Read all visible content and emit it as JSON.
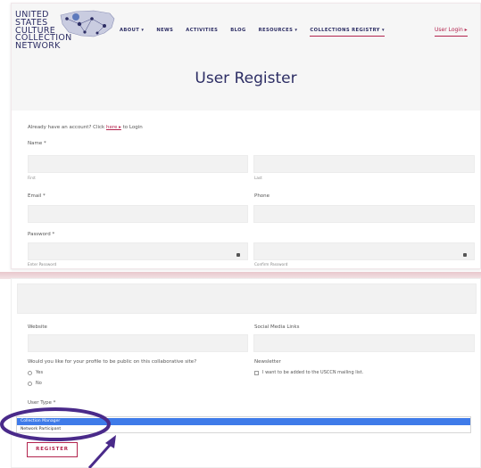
{
  "brand": {
    "logo_lines": [
      "UNITED",
      "STATES",
      "CULTURE",
      "COLLECTION",
      "NETWORK"
    ]
  },
  "nav": {
    "items": [
      "ABOUT ▾",
      "NEWS",
      "ACTIVITIES",
      "BLOG",
      "RESOURCES ▾",
      "COLLECTIONS REGISTRY ▾"
    ],
    "login": "User Login ▸"
  },
  "page": {
    "title": "User Register"
  },
  "form": {
    "login_prompt_before": "Already have an account? Click ",
    "login_link": "here ▸",
    "login_prompt_after": " to Login",
    "name_label": "Name *",
    "first_sub": "First",
    "last_sub": "Last",
    "email_label": "Email *",
    "phone_label": "Phone",
    "password_label": "Password *",
    "enter_password_sub": "Enter Password",
    "confirm_password_sub": "Confirm Password",
    "website_label": "Website",
    "social_label": "Social Media Links",
    "public_question": "Would you like for your profile to be public on this collaborative site?",
    "public_options": [
      "Yes",
      "No"
    ],
    "newsletter_label": "Newsletter",
    "newsletter_option": "I want to be added to the USCCN mailing list.",
    "user_type_label": "User Type *",
    "user_type_options": [
      "Collection Manager",
      "Network Participant"
    ],
    "register_label": "REGISTER"
  },
  "colors": {
    "accent": "#b3244e",
    "navy": "#2c2d64",
    "annotation": "#4a2a8a",
    "selection": "#3f7be9"
  }
}
